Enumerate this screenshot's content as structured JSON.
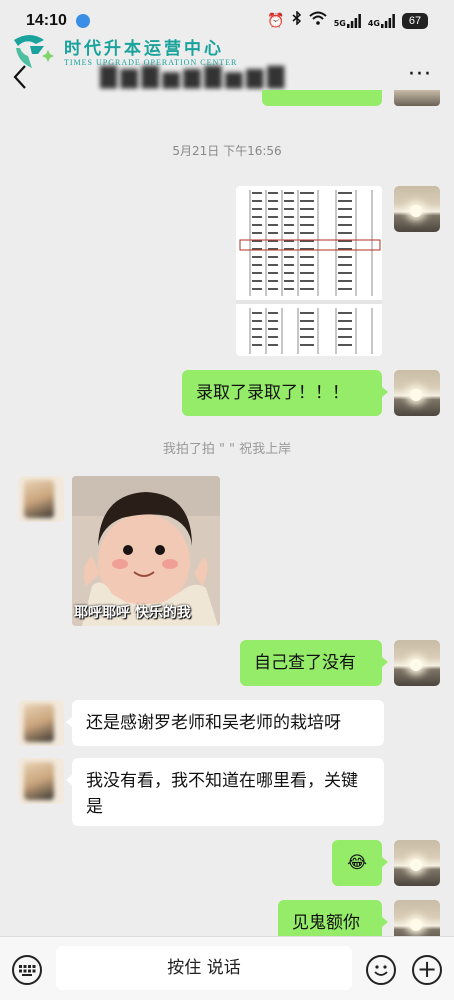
{
  "status_bar": {
    "time": "14:10",
    "signal_5g": "5G",
    "signal_4g": "4G",
    "battery": "67"
  },
  "watermark": {
    "title": "时代升本运营中心",
    "subtitle": "TIMES UPGRADE OPERATION CENTER"
  },
  "header": {
    "more_label": "···"
  },
  "messages": {
    "timestamp": "5月21日 下午16:56",
    "msg1": "录取了录取了！！！",
    "system": "我拍了拍 \"         \" 祝我上岸",
    "sticker_caption": "耶呼耶呼 快乐的我",
    "msg2": "自己查了没有",
    "msg3": "还是感谢罗老师和吴老师的栽培呀",
    "msg4": "我没有看，我不知道在哪里看，关键是",
    "msg5_emoji": "😂",
    "msg6": "见鬼额你"
  },
  "input": {
    "hold_to_talk": "按住 说话"
  },
  "colors": {
    "background": "#ededed",
    "my_bubble": "#95ec69",
    "other_bubble": "#ffffff",
    "watermark": "#1aa39c"
  }
}
